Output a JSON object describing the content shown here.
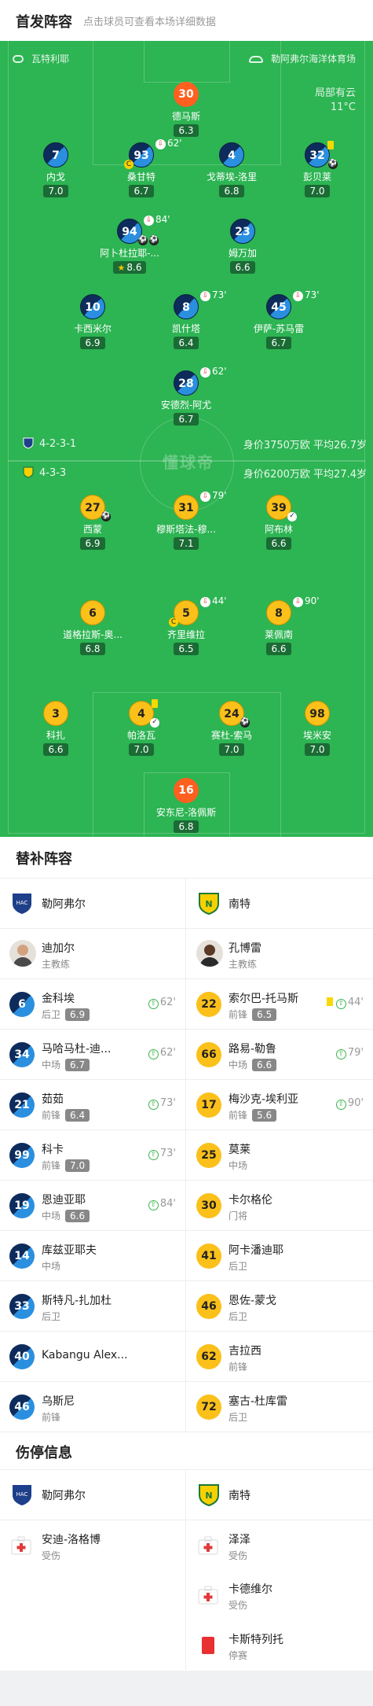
{
  "header": {
    "title": "首发阵容",
    "subtitle": "点击球员可查看本场详细数据"
  },
  "pitch": {
    "referee": "瓦特利耶",
    "stadium": "勒阿弗尔海洋体育场",
    "weather": "局部有云",
    "temperature": "11°C",
    "watermark": "懂球帝",
    "home_formation": "4-2-3-1",
    "home_info": "身价3750万欧 平均26.7岁",
    "away_formation": "4-3-3",
    "away_info": "身价6200万欧 平均27.4岁",
    "home_players": [
      {
        "no": "30",
        "name": "德马斯",
        "rating": "6.3",
        "gk": true
      },
      {
        "no": "7",
        "name": "内戈",
        "rating": "7.0"
      },
      {
        "no": "93",
        "name": "桑甘特",
        "rating": "6.7",
        "sub": "62'",
        "captain": "C"
      },
      {
        "no": "4",
        "name": "戈蒂埃-洛里",
        "rating": "6.8"
      },
      {
        "no": "32",
        "name": "彭贝莱",
        "rating": "7.0"
      },
      {
        "no": "94",
        "name": "阿卜杜拉耶-...",
        "rating": "8.6",
        "sub": "84'"
      },
      {
        "no": "23",
        "name": "姆万加",
        "rating": "6.6"
      },
      {
        "no": "10",
        "name": "卡西米尔",
        "rating": "6.9"
      },
      {
        "no": "8",
        "name": "凯什塔",
        "rating": "6.4",
        "sub": "73'"
      },
      {
        "no": "45",
        "name": "伊萨-苏马雷",
        "rating": "6.7",
        "sub": "73'"
      },
      {
        "no": "28",
        "name": "安德烈-阿尤",
        "rating": "6.7",
        "sub": "62'"
      }
    ],
    "away_players": [
      {
        "no": "27",
        "name": "西蒙",
        "rating": "6.9"
      },
      {
        "no": "31",
        "name": "穆斯塔法-穆...",
        "rating": "7.1",
        "sub": "79'"
      },
      {
        "no": "39",
        "name": "阿布林",
        "rating": "6.6"
      },
      {
        "no": "6",
        "name": "道格拉斯-奥...",
        "rating": "6.8"
      },
      {
        "no": "5",
        "name": "齐里维拉",
        "rating": "6.5",
        "sub": "44'",
        "captain": "C"
      },
      {
        "no": "8",
        "name": "莱佩南",
        "rating": "6.6",
        "sub": "90'"
      },
      {
        "no": "3",
        "name": "科扎",
        "rating": "6.6"
      },
      {
        "no": "4",
        "name": "帕洛瓦",
        "rating": "7.0"
      },
      {
        "no": "24",
        "name": "赛杜-索马",
        "rating": "7.0"
      },
      {
        "no": "98",
        "name": "埃米安",
        "rating": "7.0"
      },
      {
        "no": "16",
        "name": "安东尼-洛佩斯",
        "rating": "6.8",
        "gk": true
      }
    ]
  },
  "subs": {
    "title": "替补阵容",
    "home_team": "勒阿弗尔",
    "away_team": "南特",
    "home_coach": {
      "name": "迪加尔",
      "role": "主教练"
    },
    "away_coach": {
      "name": "孔博雷",
      "role": "主教练"
    },
    "rows": [
      {
        "h": {
          "no": "6",
          "name": "金科埃",
          "pos": "后卫",
          "rating": "6.9",
          "min": "62'"
        },
        "a": {
          "no": "22",
          "name": "索尔巴-托马斯",
          "pos": "前锋",
          "rating": "6.5",
          "min": "44'"
        }
      },
      {
        "h": {
          "no": "34",
          "name": "马哈马杜-迪...",
          "pos": "中场",
          "rating": "6.7",
          "min": "62'"
        },
        "a": {
          "no": "66",
          "name": "路易-勒鲁",
          "pos": "中场",
          "rating": "6.6",
          "min": "79'"
        }
      },
      {
        "h": {
          "no": "21",
          "name": "茹茹",
          "pos": "前锋",
          "rating": "6.4",
          "min": "73'"
        },
        "a": {
          "no": "17",
          "name": "梅沙克-埃利亚",
          "pos": "前锋",
          "rating": "5.6",
          "min": "90'"
        }
      },
      {
        "h": {
          "no": "99",
          "name": "科卡",
          "pos": "前锋",
          "rating": "7.0",
          "min": "73'"
        },
        "a": {
          "no": "25",
          "name": "莫莱",
          "pos": "中场"
        }
      },
      {
        "h": {
          "no": "19",
          "name": "恩迪亚耶",
          "pos": "中场",
          "rating": "6.6",
          "min": "84'"
        },
        "a": {
          "no": "30",
          "name": "卡尔格伦",
          "pos": "门将"
        }
      },
      {
        "h": {
          "no": "14",
          "name": "库兹亚耶夫",
          "pos": "中场"
        },
        "a": {
          "no": "41",
          "name": "阿卡潘迪耶",
          "pos": "后卫"
        }
      },
      {
        "h": {
          "no": "33",
          "name": "斯特凡-扎加杜",
          "pos": "后卫"
        },
        "a": {
          "no": "46",
          "name": "恩佐-蒙戈",
          "pos": "后卫"
        }
      },
      {
        "h": {
          "no": "40",
          "name": "Kabangu Alex..."
        },
        "a": {
          "no": "62",
          "name": "吉拉西",
          "pos": "前锋"
        }
      },
      {
        "h": {
          "no": "46",
          "name": "乌斯尼",
          "pos": "前锋"
        },
        "a": {
          "no": "72",
          "name": "塞古-杜库雷",
          "pos": "后卫"
        }
      }
    ]
  },
  "injury": {
    "title": "伤停信息",
    "home_team": "勒阿弗尔",
    "away_team": "南特",
    "home": [
      {
        "name": "安迪-洛格博",
        "status": "受伤"
      }
    ],
    "away": [
      {
        "name": "泽泽",
        "status": "受伤"
      },
      {
        "name": "卡德维尔",
        "status": "受伤"
      },
      {
        "name": "卡斯特列托",
        "status": "停赛"
      }
    ]
  },
  "colors": {
    "pitch": "#2db453",
    "home": "#2b8fe0",
    "away": "#fbc01a",
    "gk_home": "#ff5f1f"
  }
}
